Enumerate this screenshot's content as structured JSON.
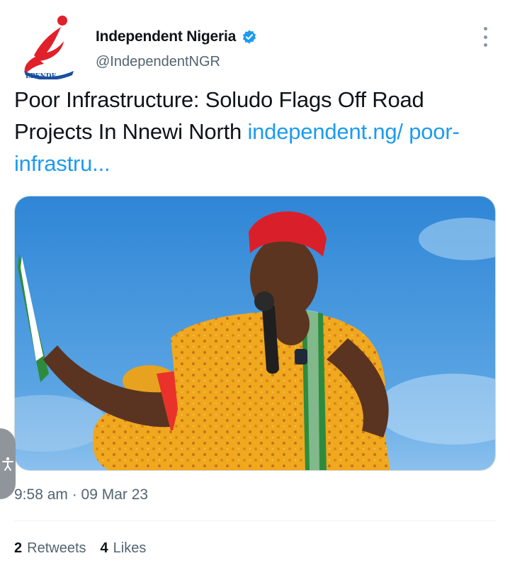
{
  "account": {
    "display_name": "Independent Nigeria",
    "handle": "@IndependentNGR",
    "logo_text": "EPENDE",
    "verified": true
  },
  "tweet": {
    "text": "Poor Infrastructure: Soludo Flags Off Road Projects In Nnewi North ",
    "link_text": "independent.ng/ poor-infrastru...",
    "timestamp": "9:58 am · 09 Mar 23",
    "media_alt": "Photo of a man in a red cap and yellow patterned shirt speaking into a microphone"
  },
  "stats": {
    "retweets_count": "2",
    "retweets_label": "Retweets",
    "likes_count": "4",
    "likes_label": "Likes"
  },
  "colors": {
    "link": "#1d9bf0",
    "verified": "#1d9bf0",
    "logo_red": "#e0202a",
    "logo_blue": "#1a4fa0"
  }
}
